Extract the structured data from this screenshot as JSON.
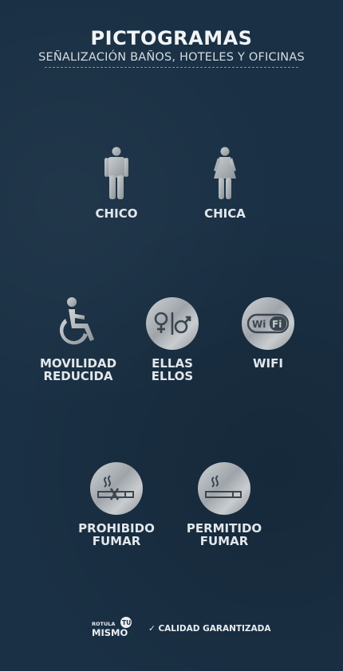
{
  "header": {
    "title": "PICTOGRAMAS",
    "subtitle": "SEÑALIZACIÓN BAÑOS, HOTELES Y OFICINAS"
  },
  "pictograms": [
    {
      "label": "CHICO",
      "icon": "man-icon"
    },
    {
      "label": "CHICA",
      "icon": "woman-icon"
    },
    {
      "label": "MOVILIDAD\nREDUCIDA",
      "icon": "wheelchair-icon"
    },
    {
      "label": "ELLAS\nELLOS",
      "icon": "gender-symbols-icon"
    },
    {
      "label": "WIFI",
      "icon": "wifi-icon"
    },
    {
      "label": "PROHIBIDO\nFUMAR",
      "icon": "no-smoking-icon"
    },
    {
      "label": "PERMITIDO\nFUMAR",
      "icon": "smoking-allowed-icon"
    }
  ],
  "footer": {
    "logo_top": "ROTULA",
    "logo_badge": "TU",
    "logo_bottom": "MISMO",
    "check": "✓",
    "quality": "CALIDAD GARANTIZADA"
  },
  "colors": {
    "background": "#1a3044",
    "text": "#e9eef2",
    "icon_metal": "#b5babe"
  }
}
